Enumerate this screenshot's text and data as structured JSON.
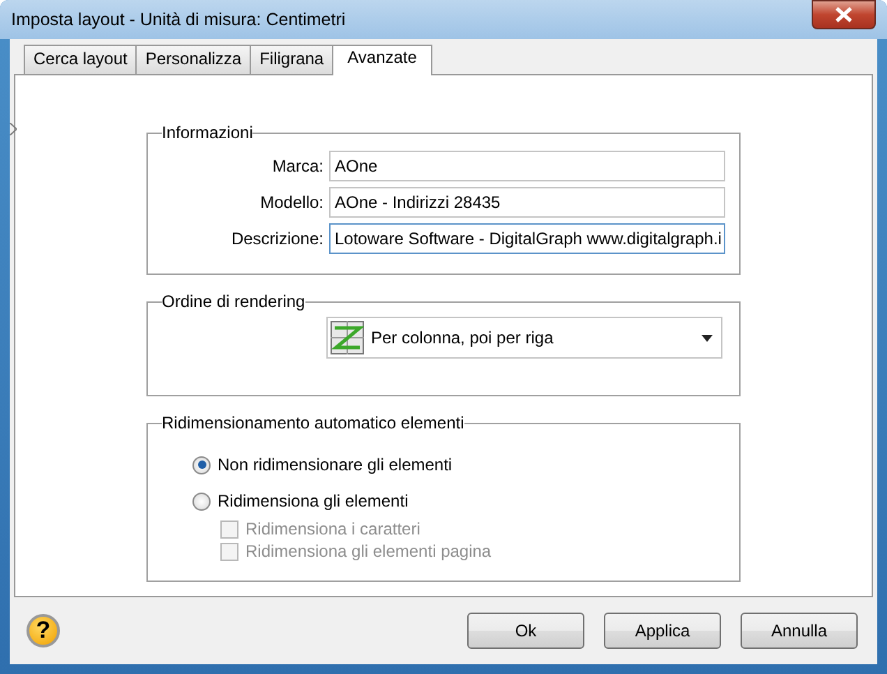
{
  "window": {
    "title": "Imposta layout - Unità di misura: Centimetri"
  },
  "tabs": [
    {
      "label": "Cerca layout",
      "selected": false
    },
    {
      "label": "Personalizza",
      "selected": false
    },
    {
      "label": "Filigrana",
      "selected": false
    },
    {
      "label": "Avanzate",
      "selected": true
    }
  ],
  "info_group": {
    "title": "Informazioni",
    "fields": [
      {
        "label": "Marca:",
        "value": "AOne"
      },
      {
        "label": "Modello:",
        "value": "AOne - Indirizzi 28435"
      },
      {
        "label": "Descrizione:",
        "value": "Lotoware Software - DigitalGraph www.digitalgraph.i"
      }
    ]
  },
  "render_group": {
    "title": "Ordine di rendering",
    "dropdown": {
      "value": "Per colonna, poi per riga"
    }
  },
  "resize_group": {
    "title": "Ridimensionamento automatico elementi",
    "options": [
      {
        "kind": "radio",
        "label": "Non ridimensionare gli elementi",
        "selected": true
      },
      {
        "kind": "radio",
        "label": "Ridimensiona gli elementi",
        "selected": false
      },
      {
        "kind": "checkbox",
        "label": "Ridimensiona i caratteri",
        "checked": false,
        "disabled": true
      },
      {
        "kind": "checkbox",
        "label": "Ridimensiona gli elementi pagina",
        "checked": false,
        "disabled": true
      }
    ]
  },
  "help": {
    "glyph": "?"
  },
  "buttons": [
    "Ok",
    "Applica",
    "Annulla"
  ]
}
